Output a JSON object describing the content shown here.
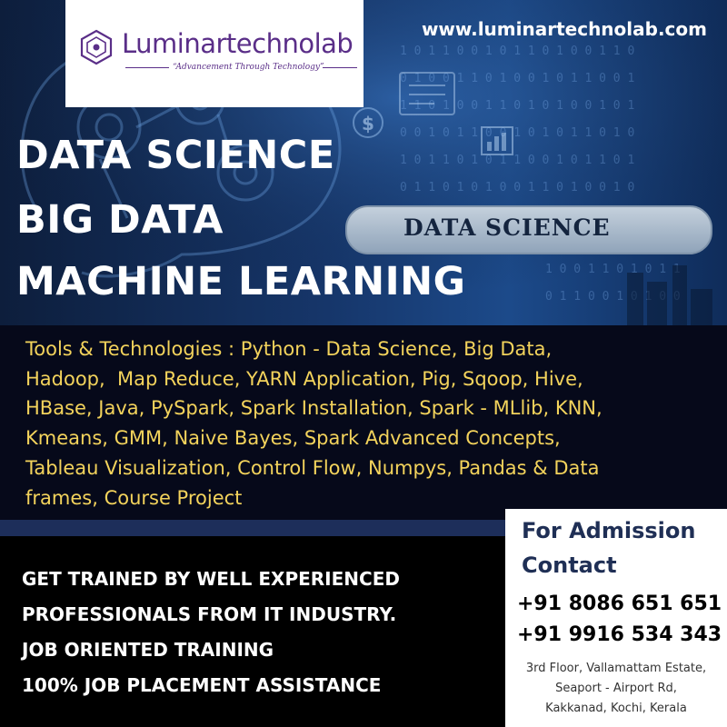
{
  "brand": {
    "name": "Luminartechnolab",
    "tagline": "“Advancement Through Technology”",
    "website": "www.luminartechnolab.com",
    "purple": "#5a2e88"
  },
  "headlines": [
    "DATA SCIENCE",
    "BIG DATA",
    "MACHINE LEARNING"
  ],
  "decor": {
    "pill_text": "DATA SCIENCE",
    "icons": [
      "brain-gear-icon",
      "dollar-icon",
      "bar-chart-icon",
      "document-icon"
    ]
  },
  "tools": {
    "lines": [
      "Tools & Technologies : Python - Data Science, Big Data,",
      "Hadoop,  Map Reduce, YARN Application, Pig, Sqoop, Hive,",
      "HBase, Java, PySpark, Spark Installation, Spark - MLlib, KNN,",
      "Kmeans, GMM, Naive Bayes, Spark Advanced Concepts,",
      "Tableau Visualization, Control Flow, Numpys, Pandas & Data",
      "frames, Course Project"
    ],
    "color": "#f3d35c"
  },
  "promo": [
    "GET TRAINED BY WELL EXPERIENCED",
    "PROFESSIONALS FROM IT INDUSTRY.",
    "JOB ORIENTED TRAINING",
    "100% JOB PLACEMENT ASSISTANCE"
  ],
  "contact": {
    "title_lines": [
      "For Admission",
      "Contact"
    ],
    "phones": [
      "+91 8086 651 651",
      "+91 9916 534 343"
    ],
    "address_lines": [
      "3rd Floor, Vallamattam Estate,",
      "Seaport - Airport Rd,",
      "Kakkanad, Kochi, Kerala"
    ]
  }
}
